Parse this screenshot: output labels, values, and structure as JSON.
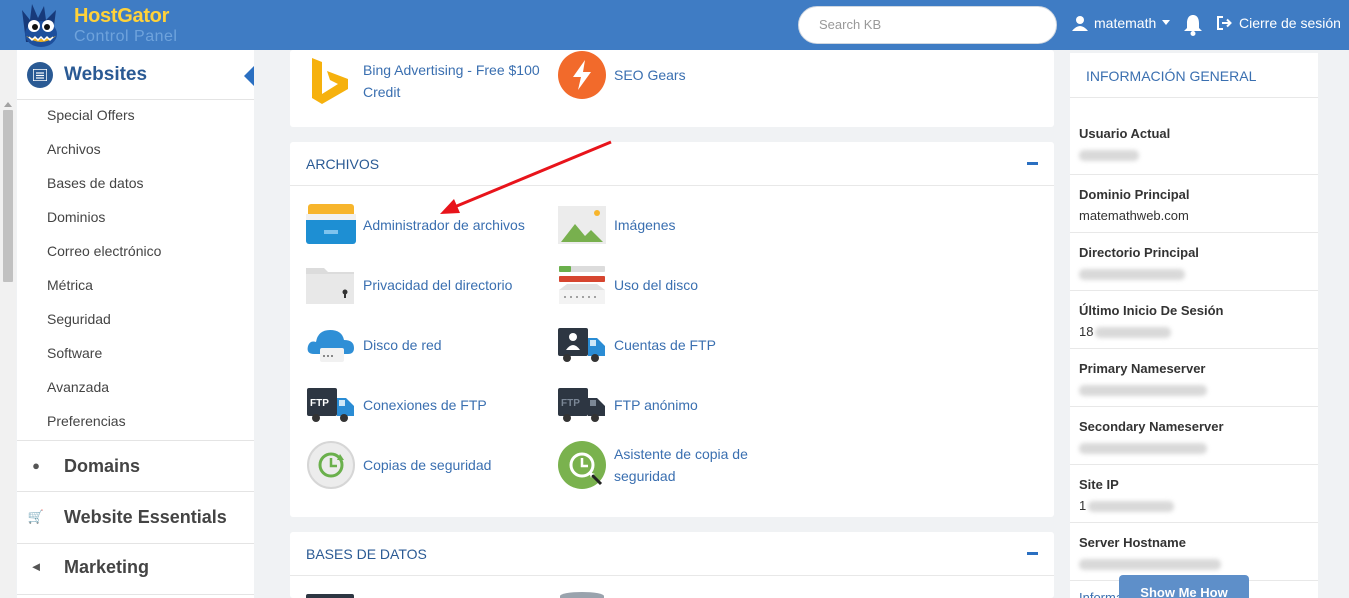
{
  "header": {
    "logo_word": "HostGator",
    "logo_sub": "Control Panel",
    "search_placeholder": "Search KB",
    "username": "matemath",
    "logout_label": "Cierre de sesión"
  },
  "sidebar": {
    "section_title": "Websites",
    "items": [
      {
        "label": "Special Offers"
      },
      {
        "label": "Archivos"
      },
      {
        "label": "Bases de datos"
      },
      {
        "label": "Dominios"
      },
      {
        "label": "Correo electrónico"
      },
      {
        "label": "Métrica"
      },
      {
        "label": "Seguridad"
      },
      {
        "label": "Software"
      },
      {
        "label": "Avanzada"
      },
      {
        "label": "Preferencias"
      }
    ],
    "categories": [
      {
        "label": "Domains",
        "icon": "globe-icon"
      },
      {
        "label": "Website Essentials",
        "icon": "cart-icon"
      },
      {
        "label": "Marketing",
        "icon": "megaphone-icon"
      }
    ]
  },
  "top_panel": {
    "items": [
      {
        "label": "Bing Advertising - Free $100 Credit",
        "icon": "bing-icon"
      },
      {
        "label": "SEO Gears",
        "icon": "seo-gears-icon"
      }
    ]
  },
  "archivos": {
    "title": "ARCHIVOS",
    "items": [
      {
        "label": "Administrador de archivos",
        "icon": "file-manager-icon"
      },
      {
        "label": "Imágenes",
        "icon": "images-icon"
      },
      {
        "label": "Privacidad del directorio",
        "icon": "directory-privacy-icon"
      },
      {
        "label": "Uso del disco",
        "icon": "disk-usage-icon"
      },
      {
        "label": "Disco de red",
        "icon": "web-disk-icon"
      },
      {
        "label": "Cuentas de FTP",
        "icon": "ftp-accounts-icon"
      },
      {
        "label": "Conexiones de FTP",
        "icon": "ftp-connections-icon"
      },
      {
        "label": "FTP anónimo",
        "icon": "anonymous-ftp-icon"
      },
      {
        "label": "Copias de seguridad",
        "icon": "backup-icon"
      },
      {
        "label": "Asistente de copia de seguridad",
        "icon": "backup-wizard-icon"
      }
    ]
  },
  "bases": {
    "title": "BASES DE DATOS"
  },
  "info": {
    "title": "INFORMACIÓN GENERAL",
    "rows": [
      {
        "key": "Usuario Actual",
        "value": ""
      },
      {
        "key": "Dominio Principal",
        "value": "matemathweb.com"
      },
      {
        "key": "Directorio Principal",
        "value": ""
      },
      {
        "key": "Último Inicio De Sesión",
        "value": "18"
      },
      {
        "key": "Primary Nameserver",
        "value": ""
      },
      {
        "key": "Secondary Nameserver",
        "value": ""
      },
      {
        "key": "Site IP",
        "value": "1"
      },
      {
        "key": "Server Hostname",
        "value": ""
      }
    ],
    "more_link": "Informa",
    "show_me_how": "Show Me How"
  },
  "colors": {
    "header": "#3f7cc4",
    "link": "#3a6fb0",
    "annotation_arrow": "#e8141b"
  }
}
